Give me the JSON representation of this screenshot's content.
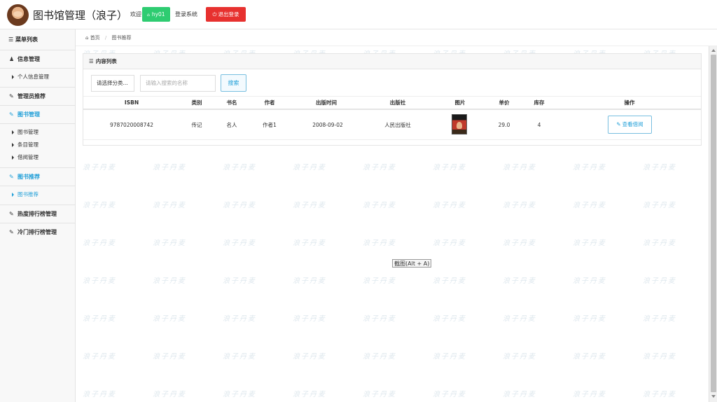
{
  "header": {
    "app_title": "图书馆管理（浪子）",
    "welcome": "欢迎",
    "user_icon": "home-icon",
    "username": "hy01",
    "login_system": "登录系统",
    "logout_icon": "power-icon",
    "logout_label": "退出登录"
  },
  "sidebar": {
    "title": "菜单列表",
    "groups": [
      {
        "label": "信息管理",
        "icon": "user-icon",
        "items": [
          "个人信息管理"
        ]
      },
      {
        "label": "管理员推荐",
        "icon": "edit-icon",
        "items": []
      },
      {
        "label": "图书管理",
        "icon": "edit-icon",
        "active": true,
        "items": [
          "图书管理",
          "条目管理",
          "借阅管理"
        ]
      },
      {
        "label": "图书推荐",
        "icon": "edit-icon",
        "active": true,
        "items": [
          "图书推荐"
        ]
      },
      {
        "label": "热度排行榜管理",
        "icon": "edit-icon",
        "items": []
      },
      {
        "label": "冷门排行榜管理",
        "icon": "edit-icon",
        "items": []
      }
    ]
  },
  "breadcrumb": {
    "home": "首页",
    "current": "图书推荐"
  },
  "panel": {
    "title": "内容列表",
    "select_placeholder": "请选择分类...",
    "search_placeholder": "请输入搜索的名称",
    "search_label": "搜索"
  },
  "table": {
    "columns": [
      "ISBN",
      "类别",
      "书名",
      "作者",
      "出版时间",
      "出版社",
      "图片",
      "单价",
      "库存",
      "操作"
    ],
    "rows": [
      {
        "isbn": "9787020008742",
        "category": "传记",
        "title": "名人",
        "author": "作者1",
        "date": "2008-09-02",
        "publisher": "人民出版社",
        "price": "29.0",
        "stock": "4",
        "action": "查看借阅"
      }
    ]
  },
  "watermark": "浪子丹麦",
  "tooltip": "截图(Alt + A)",
  "colors": {
    "accent": "#23a0d8",
    "success": "#2ecc71",
    "danger": "#e7312f"
  }
}
